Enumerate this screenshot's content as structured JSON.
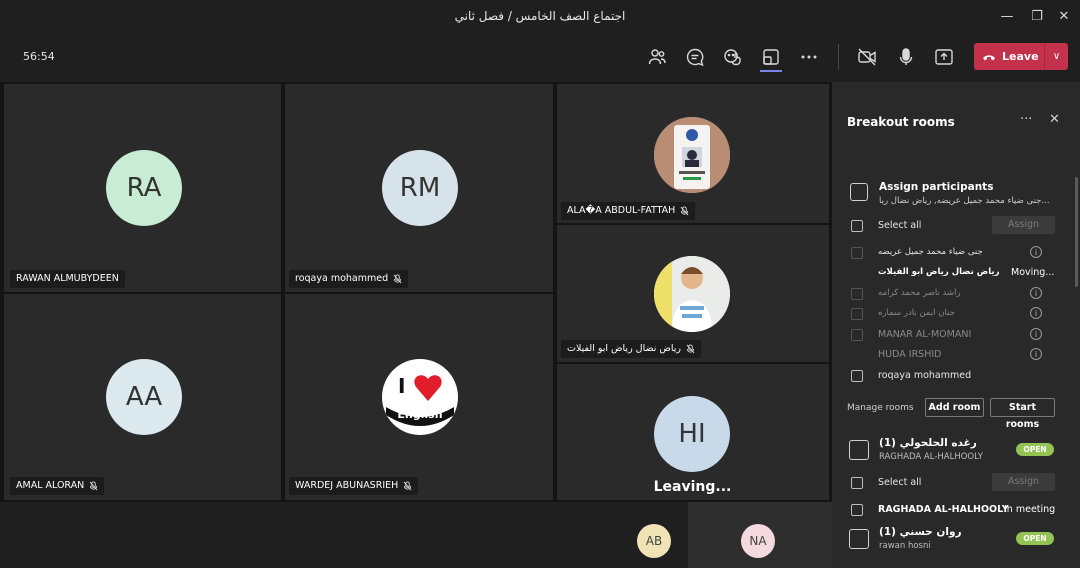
{
  "window": {
    "title": "اجتماع الصف الخامس / فصل ثاني"
  },
  "toolbar": {
    "timer": "56:54",
    "leave_label": "Leave"
  },
  "tiles": [
    {
      "initials": "RA",
      "name": "RAWAN ALMUBYDEEN",
      "avatar_color": "#c9ecd4"
    },
    {
      "initials": "RM",
      "name": "roqaya mohammed",
      "avatar_color": "#d7e3ea"
    },
    {
      "initials": "AA",
      "name": "AMAL ALORAN",
      "avatar_color": "#dce9ef"
    },
    {
      "initials": "",
      "name": "WARDEJ ABUNASRIEH",
      "avatar_color": "#ffffff"
    },
    {
      "initials": "",
      "name": "ALA�A ABDUL-FATTAH",
      "avatar_color": "#c9d5e4"
    },
    {
      "initials": "",
      "name": "رياض نضال رياض ابو الفيلات",
      "avatar_color": "#c9d5e4"
    },
    {
      "initials": "HI",
      "name": "",
      "avatar_color": "#c8d9ea"
    }
  ],
  "logo": {
    "top": "I",
    "bottom": "English"
  },
  "leaving_text": "Leaving...",
  "bottom_avatars": [
    {
      "initials": "AB",
      "color": "#f1e3b5"
    },
    {
      "initials": "NA",
      "color": "#f4d9de"
    }
  ],
  "panel": {
    "title": "Breakout rooms",
    "assign_title": "Assign participants",
    "assign_sub": "جنى ضياء محمد جميل عريضه, رياض نضال ريا...",
    "select_all": "Select all",
    "assign_button": "Assign",
    "participants": [
      {
        "name": "جنى ضياء محمد جميل عريضه",
        "dim": true
      },
      {
        "name": "رياض نضال رياض ابو الفيلات",
        "status": "Moving..."
      },
      {
        "name": "راشد ناصر محمد كرامه",
        "dim": true
      },
      {
        "name": "جنان ايمن نادر سماره",
        "dim": true
      },
      {
        "name": "MANAR AL-MOMANI",
        "dim": true
      },
      {
        "name": "HUDA IRSHID",
        "dim": true
      },
      {
        "name": "roqaya mohammed"
      }
    ],
    "manage_rooms": "Manage rooms",
    "add_room": "Add room",
    "start_rooms": "Start rooms",
    "rooms": [
      {
        "name": "رغده الحلحولي (1)",
        "sub": "RAGHADA AL-HALHOOLY",
        "status": "OPEN",
        "select_all": "Select all",
        "assign": "Assign",
        "member": "RAGHADA AL-HALHOOLY",
        "member_status": "In meeting"
      },
      {
        "name": "روان حسني (1)",
        "sub": "rawan hosni",
        "status": "OPEN"
      }
    ]
  },
  "colors": {
    "leave": "#c4314b",
    "open_badge": "#92c353",
    "panel_bg": "#292929",
    "tile_bg": "#2a2a2a"
  }
}
